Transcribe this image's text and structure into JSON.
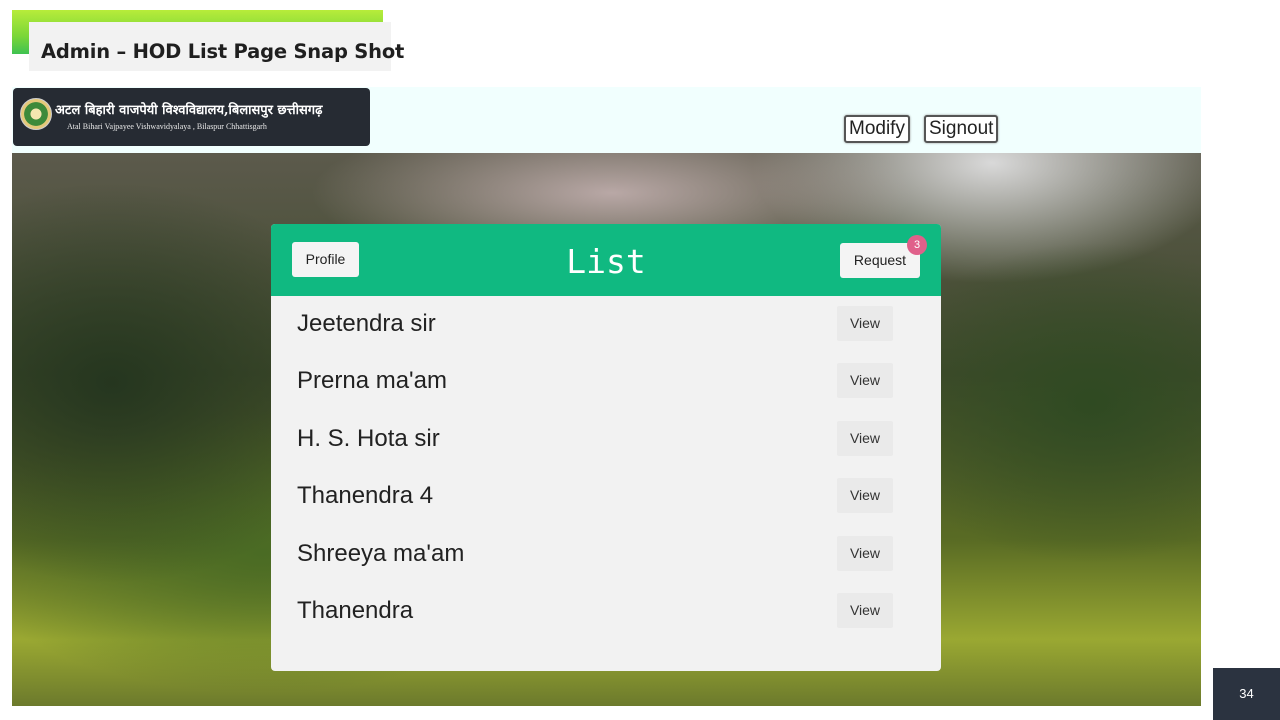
{
  "slide": {
    "title": "Admin – HOD List Page Snap Shot",
    "page_number": "34"
  },
  "header": {
    "logo_hindi": "अटल बिहारी वाजपेयी विश्वविद्यालय,बिलासपुर छत्तीसगढ़",
    "logo_english": "Atal Bihari Vajpayee Vishwavidyalaya , Bilaspur Chhattisgarh",
    "modify_label": "Modify",
    "signout_label": "Signout"
  },
  "card": {
    "title": "List",
    "profile_label": "Profile",
    "request_label": "Request",
    "request_badge": "3",
    "rows": [
      {
        "name": "Jeetendra sir",
        "action": "View"
      },
      {
        "name": "Prerna ma'am",
        "action": "View"
      },
      {
        "name": "H. S. Hota sir",
        "action": "View"
      },
      {
        "name": "Thanendra 4",
        "action": "View"
      },
      {
        "name": "Shreeya ma'am",
        "action": "View"
      },
      {
        "name": "Thanendra",
        "action": "View"
      }
    ]
  },
  "colors": {
    "accent_green": "#10b981",
    "badge_pink": "#e0608a",
    "title_gradient_top": "#b7ec3a",
    "title_gradient_bottom": "#3fc251"
  },
  "icons": {
    "logo_emblem": "university-emblem-icon"
  }
}
